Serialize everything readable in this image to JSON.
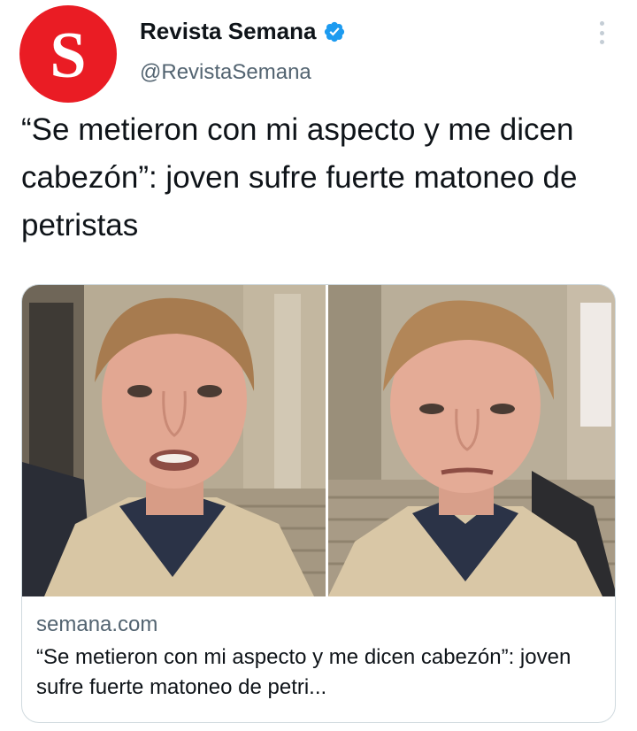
{
  "account": {
    "avatar_letter": "S",
    "name": "Revista Semana",
    "handle": "@RevistaSemana",
    "verified": true,
    "brand_color": "#ea1c24",
    "verified_color": "#1d9bf0"
  },
  "tweet": {
    "text": "“Se metieron con mi aspecto y me dicen cabezón”: joven sufre fuerte matoneo de petristas"
  },
  "link_card": {
    "image_description_icons": [
      "person-photo-left",
      "person-photo-right"
    ],
    "domain": "semana.com",
    "title": "“Se metieron con mi aspecto y me dicen cabezón”: joven sufre fuerte matoneo de petri..."
  },
  "icons": {
    "more": "more-vertical-icon",
    "verified": "verified-badge-icon"
  }
}
